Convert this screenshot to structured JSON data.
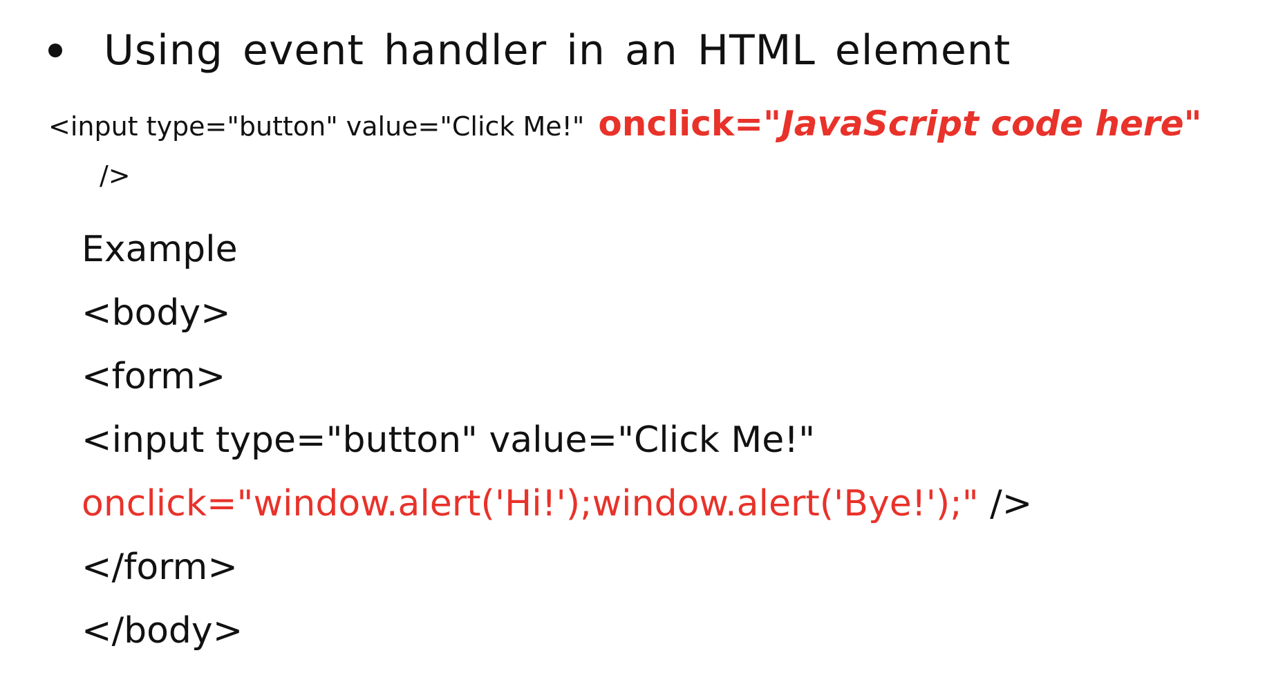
{
  "slide": {
    "bullet_text": "Using event handler in an HTML element",
    "syntax": {
      "code_prefix": "<input type=\"button\" value=\"Click Me!\"",
      "handler_attr": "onclick=\"",
      "handler_value": "JavaScript code here\"",
      "closing": "/>"
    },
    "example": {
      "label": "Example",
      "lines": [
        "<body>",
        "<form>",
        "<input type=\"button\" value=\"Click Me!\""
      ],
      "onclick_line": {
        "handler": "onclick=\"window.alert('Hi!');window.alert('Bye!');\"",
        "tail": " />"
      },
      "closing_lines": [
        "</form>",
        "</body>"
      ]
    },
    "colors": {
      "text": "#111111",
      "accent_red": "#e8322a",
      "background": "#ffffff"
    }
  }
}
